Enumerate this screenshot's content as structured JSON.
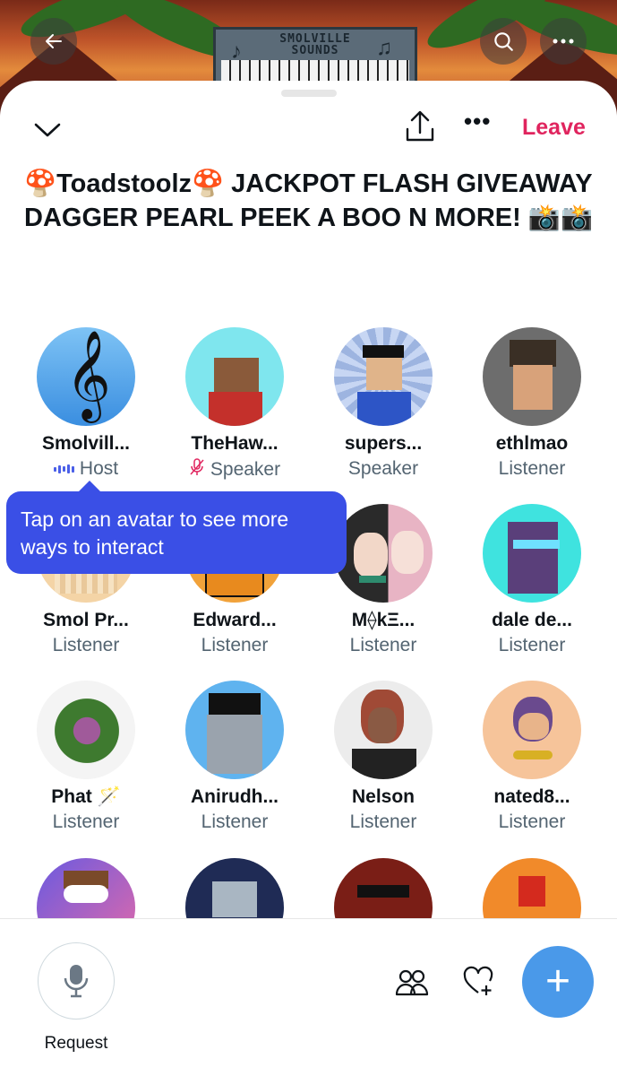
{
  "banner": {
    "title_line1": "SMOLVILLE",
    "title_line2": "SOUNDS",
    "back_icon": "arrow-left-icon",
    "search_icon": "search-icon",
    "more_icon": "more-horizontal-icon"
  },
  "topbar": {
    "collapse_icon": "chevron-down-icon",
    "share_icon": "share-icon",
    "more_label": "•••",
    "leave_label": "Leave"
  },
  "space": {
    "title_emoji_start": "🍄",
    "title_part1": "Toadstoolz",
    "title_emoji_mid": "🍄",
    "title_part2": " JACKPOT FLASH GIVEAWAY DAGGER PEARL PEEK A BOO N MORE! ",
    "title_emoji_end": "📸📸"
  },
  "participants": [
    {
      "name": "Smolvill...",
      "role": "Host",
      "role_icon": "audio-bars-icon"
    },
    {
      "name": "TheHaw...",
      "role": "Speaker",
      "role_icon": "mic-off-icon"
    },
    {
      "name": "supers...",
      "role": "Speaker"
    },
    {
      "name": "ethlmao",
      "role": "Listener"
    },
    {
      "name": "Smol Pr...",
      "role": "Listener"
    },
    {
      "name": "Edward...",
      "role": "Listener"
    },
    {
      "name": "M⟠kΞ...",
      "role": "Listener"
    },
    {
      "name": "dale de...",
      "role": "Listener"
    },
    {
      "name": "Phat 🪄",
      "role": "Listener"
    },
    {
      "name": "Anirudh...",
      "role": "Listener"
    },
    {
      "name": "Nelson",
      "role": "Listener"
    },
    {
      "name": "nated8...",
      "role": "Listener"
    }
  ],
  "tooltip": {
    "text": "Tap on an avatar to see more ways to interact"
  },
  "bottombar": {
    "request_label": "Request",
    "request_icon": "microphone-icon",
    "people_icon": "people-icon",
    "reaction_icon": "heart-plus-icon",
    "plus_label": "+"
  },
  "colors": {
    "leave": "#e0245e",
    "tooltip": "#3a4fe6",
    "fab": "#4a99e9",
    "secondary_text": "#536471"
  }
}
